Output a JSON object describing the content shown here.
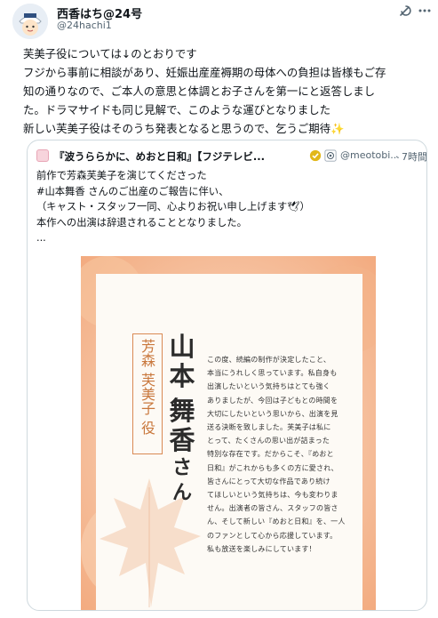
{
  "tweet": {
    "display_name": "西香はち@24号",
    "handle": "@24hachi1",
    "lines": [
      "芙美子役については↓のとおりです",
      "フジから事前に相談があり、妊娠出産産褥期の母体への負担は皆様もご存",
      "知の通りなので、ご本人の意思と体調とお子さんを第一にと返答しまし",
      "た。ドラマサイドも同じ見解で、このような運びとなりました",
      "新しい芙美子役はそのうち発表となると思うので、乞うご期待✨"
    ]
  },
  "quote": {
    "display_name": "『波うららかに、めおと日和』【フジテレビ...",
    "handle": "@meotobi...",
    "time": "· 7時間",
    "lines": [
      "前作で芳森芙美子を演じてくださった",
      "#山本舞香 さんのご出産のご報告に伴い、",
      "（キャスト・スタッフ一同、心よりお祝い申し上げます🕊）",
      "本作への出演は辞退されることとなりました。",
      "..."
    ],
    "card": {
      "role": [
        "芳",
        "森",
        " ",
        "芙",
        "美",
        "子",
        " ",
        "役"
      ],
      "name_big": [
        "山",
        "本",
        "舞",
        "香"
      ],
      "name_small": [
        "さ",
        "ん"
      ],
      "message_lines": [
        "この度、続編の制作が決定したこと、",
        "本当にうれしく思っています。私自身も",
        "出演したいという気持ちはとても強く",
        "ありましたが、今回は子どもとの時間を",
        "大切にしたいという思いから、出演を見",
        "送る決断を致しました。芙美子は私に",
        "とって、たくさんの思い出が詰まった",
        "特別な存在です。だからこそ、『めおと",
        "日和』がこれからも多くの方に愛され、",
        "皆さんにとって大切な作品であり続け",
        "てほしいという気持ちは、今も変わりま",
        "せん。出演者の皆さん、スタッフの皆さ",
        "ん、そして新しい『めおと日和』を、一人",
        "のファンとして心から応援しています。",
        "私も放送を楽しみにしています！"
      ]
    }
  },
  "colors": {
    "text": "#0f1419",
    "muted": "#536471",
    "border": "#cfd9de",
    "card_orange": "#f3b98f",
    "role_orange": "#c9783d",
    "verified_gold": "#e2b719"
  },
  "icons": [
    "grok-icon",
    "more-icon",
    "verified-badge-icon",
    "affiliate-icon",
    "maple-leaf-icon",
    "avatar-sailor"
  ]
}
